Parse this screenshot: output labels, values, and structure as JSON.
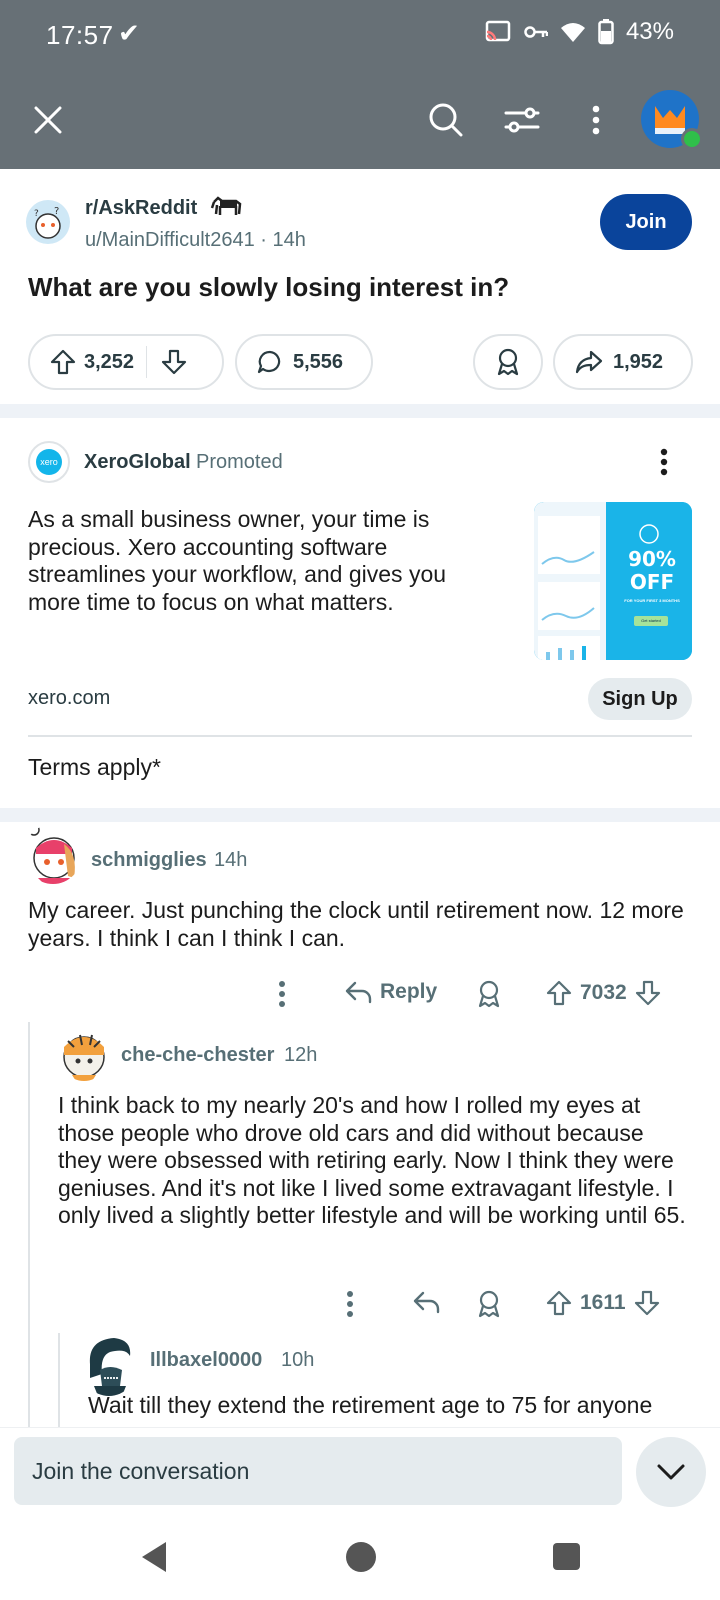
{
  "status_bar": {
    "time": "17:57",
    "battery": "43%"
  },
  "app_bar": {
    "icons": [
      "close-icon",
      "search-icon",
      "filter-icon",
      "more-vertical-icon",
      "avatar"
    ]
  },
  "post": {
    "subreddit": "r/AskReddit",
    "author": "u/MainDifficult2641",
    "age": "14h",
    "join_label": "Join",
    "title": "What are you slowly losing interest in?",
    "upvotes": "3,252",
    "comments": "5,556",
    "shares": "1,952"
  },
  "ad": {
    "advertiser": "XeroGlobal",
    "promoted_label": "Promoted",
    "logo_text": "xero",
    "body": "As a small business owner, your time is precious. Xero accounting software streamlines your workflow, and gives you more time to focus on what matters.",
    "image_headline": "90% OFF",
    "image_sub": "FOR YOUR FIRST 3 MONTHS",
    "image_cta": "Get started",
    "domain": "xero.com",
    "cta_label": "Sign Up",
    "terms": "Terms apply*"
  },
  "comments": [
    {
      "user": "schmigglies",
      "age": "14h",
      "body": "My career. Just punching the clock until retirement now. 12 more years. I think I can I think I can.",
      "reply_label": "Reply",
      "score": "7032"
    },
    {
      "user": "che-che-chester",
      "age": "12h",
      "body": "I think back to my nearly 20's and how I rolled my eyes at those people who drove old cars and did without because they were obsessed with retiring early. Now I think they were geniuses. And it's not like I lived some extravagant lifestyle. I only lived a slightly better lifestyle and will be working until 65.",
      "score": "1611"
    },
    {
      "user": "Illbaxel0000",
      "age": "10h",
      "body": "Wait till they extend the retirement age to 75 for anyone"
    }
  ],
  "composer": {
    "placeholder": "Join the conversation"
  },
  "colors": {
    "app_bar": "#677076",
    "join_button": "#0a449b",
    "meta_text": "#576f76"
  }
}
